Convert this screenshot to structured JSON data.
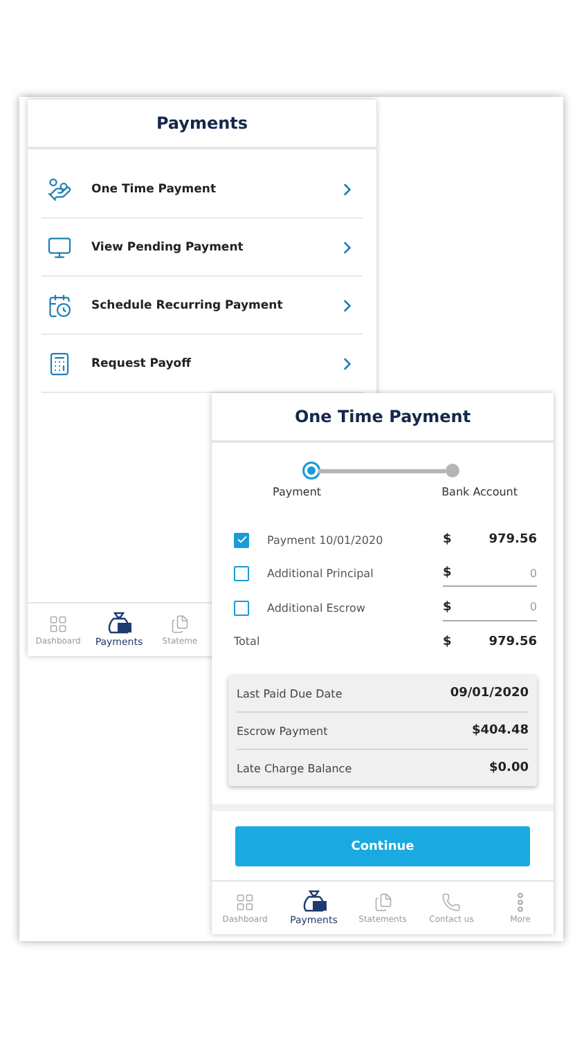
{
  "payments_screen": {
    "title": "Payments",
    "items": [
      {
        "label": "One Time Payment"
      },
      {
        "label": "View Pending Payment"
      },
      {
        "label": "Schedule Recurring Payment"
      },
      {
        "label": "Request Payoff"
      }
    ],
    "nav": [
      {
        "label": "Dashboard",
        "selected": false
      },
      {
        "label": "Payments",
        "selected": true
      },
      {
        "label": "Stateme",
        "selected": false
      }
    ]
  },
  "one_time_payment_screen": {
    "title": "One Time Payment",
    "steps": [
      {
        "label": "Payment",
        "selected": true
      },
      {
        "label": "Bank Account",
        "selected": false
      }
    ],
    "lines": [
      {
        "kind": "fixed",
        "label": "Payment 10/01/2020",
        "checked": true,
        "currency": "$",
        "amount": "979.56"
      },
      {
        "kind": "input",
        "label": "Additional Principal",
        "checked": false,
        "currency": "$",
        "placeholder": "0"
      },
      {
        "kind": "input",
        "label": "Additional Escrow",
        "checked": false,
        "currency": "$",
        "placeholder": "0"
      },
      {
        "kind": "total",
        "label": "Total",
        "currency": "$",
        "amount": "979.56"
      }
    ],
    "summary": [
      {
        "label": "Last Paid Due Date",
        "value": "09/01/2020"
      },
      {
        "label": "Escrow Payment",
        "value": "$404.48"
      },
      {
        "label": "Late Charge Balance",
        "value": "$0.00"
      }
    ],
    "button": "Continue",
    "nav": [
      {
        "label": "Dashboard",
        "selected": false
      },
      {
        "label": "Payments",
        "selected": true
      },
      {
        "label": "Statements",
        "selected": false
      },
      {
        "label": "Contact us",
        "selected": false
      },
      {
        "label": "More",
        "selected": false
      }
    ]
  }
}
